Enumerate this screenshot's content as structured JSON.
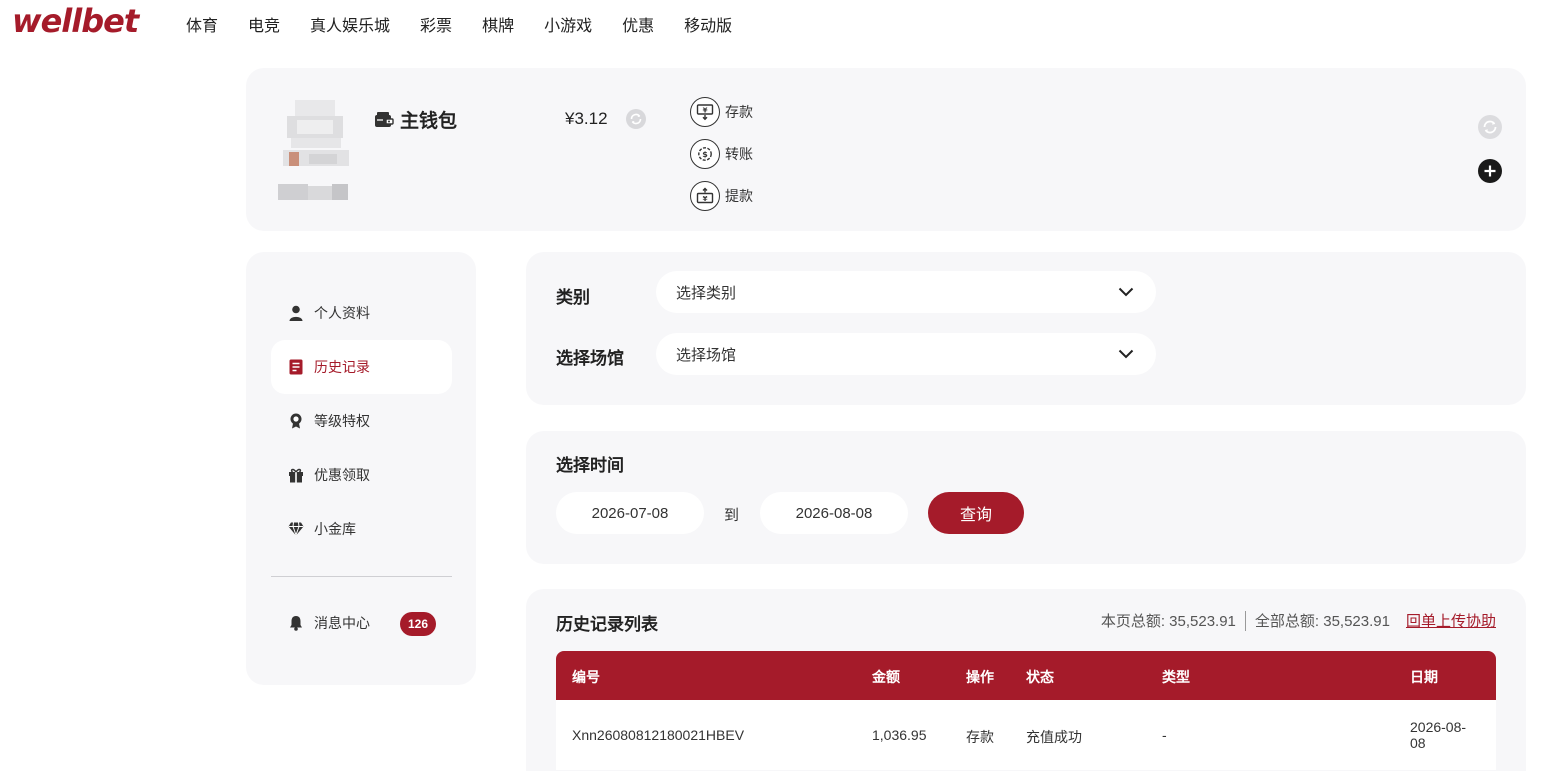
{
  "brand": {
    "logo_text": "wellbet",
    "accent": "#a51b2a"
  },
  "nav": {
    "items": [
      "体育",
      "电竞",
      "真人娱乐城",
      "彩票",
      "棋牌",
      "小游戏",
      "优惠",
      "移动版"
    ]
  },
  "wallet": {
    "title": "主钱包",
    "balance": "¥3.12",
    "actions": [
      {
        "label": "存款",
        "icon": "deposit-icon"
      },
      {
        "label": "转账",
        "icon": "transfer-icon"
      },
      {
        "label": "提款",
        "icon": "withdraw-icon"
      }
    ]
  },
  "sidebar": {
    "items": [
      {
        "label": "个人资料",
        "icon": "user-icon"
      },
      {
        "label": "历史记录",
        "icon": "history-icon",
        "active": true
      },
      {
        "label": "等级特权",
        "icon": "medal-icon"
      },
      {
        "label": "优惠领取",
        "icon": "gift-icon"
      },
      {
        "label": "小金库",
        "icon": "diamond-icon"
      }
    ],
    "messages": {
      "label": "消息中心",
      "icon": "bell-icon",
      "badge": "126"
    }
  },
  "filters": {
    "category_label": "类别",
    "category_placeholder": "选择类别",
    "venue_label": "选择场馆",
    "venue_placeholder": "选择场馆"
  },
  "date_range": {
    "title": "选择时间",
    "start": "2026-07-08",
    "to_label": "到",
    "end": "2026-08-08",
    "query_label": "查询"
  },
  "history": {
    "title": "历史记录列表",
    "page_total": "本页总额: 35,523.91",
    "all_total": "全部总额: 35,523.91",
    "help_link": "回单上传协助",
    "columns": [
      "编号",
      "金额",
      "操作",
      "状态",
      "类型",
      "日期"
    ],
    "rows": [
      [
        "Xnn26080812180021HBEV",
        "1,036.95",
        "存款",
        "充值成功",
        "-",
        "2026-08-08"
      ]
    ]
  }
}
